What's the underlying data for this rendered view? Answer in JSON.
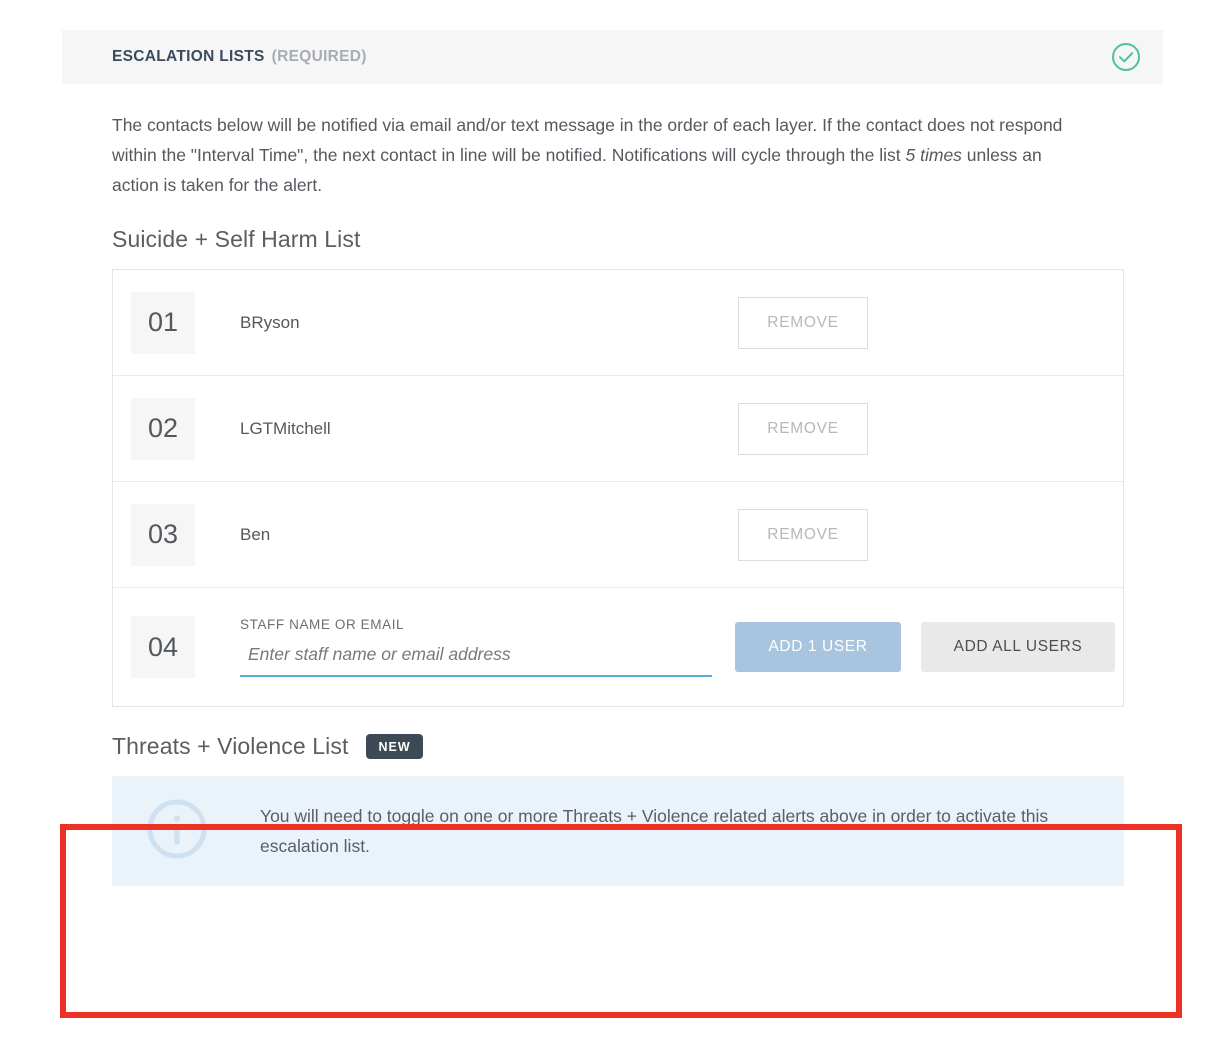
{
  "card": {
    "header": {
      "title": "ESCALATION LISTS",
      "required_label": "(REQUIRED)",
      "status_icon": "check-circle-icon",
      "status_color": "#4ec19a"
    },
    "intro_line1": "The contacts below will be notified via email and/or text message in the order of each layer. If the",
    "intro_line2": "contact does not respond within the \"Interval Time\", the next contact in line will be notified.",
    "intro_line3_before": "Notifications will cycle through the list ",
    "intro_emphasis": "5 times",
    "intro_line3_after": " unless an action is taken for the alert."
  },
  "suicide_list": {
    "title": "Suicide + Self Harm List",
    "rows": [
      {
        "order": "01",
        "name": "BRyson",
        "remove_label": "REMOVE"
      },
      {
        "order": "02",
        "name": "LGTMitchell",
        "remove_label": "REMOVE"
      },
      {
        "order": "03",
        "name": "Ben",
        "remove_label": "REMOVE"
      }
    ],
    "add_row": {
      "order": "04",
      "field_label": "STAFF NAME OR EMAIL",
      "field_value": "",
      "field_placeholder": "Enter staff name or email address",
      "add_one_label": "ADD 1 USER",
      "add_all_label": "ADD ALL USERS",
      "add_one_color": "#a8c4de",
      "add_all_color": "#e9e9e9"
    }
  },
  "threats_list": {
    "title": "Threats + Violence List",
    "badge": "NEW",
    "badge_color": "#3d4a56",
    "notice": {
      "icon": "info-circle-icon",
      "background": "#eaf2fa",
      "line1": "You will need to toggle on one or more Threats + Violence related alerts above in order",
      "line2": "to activate this escalation list."
    }
  },
  "annotation": {
    "color": "#ee3124"
  }
}
